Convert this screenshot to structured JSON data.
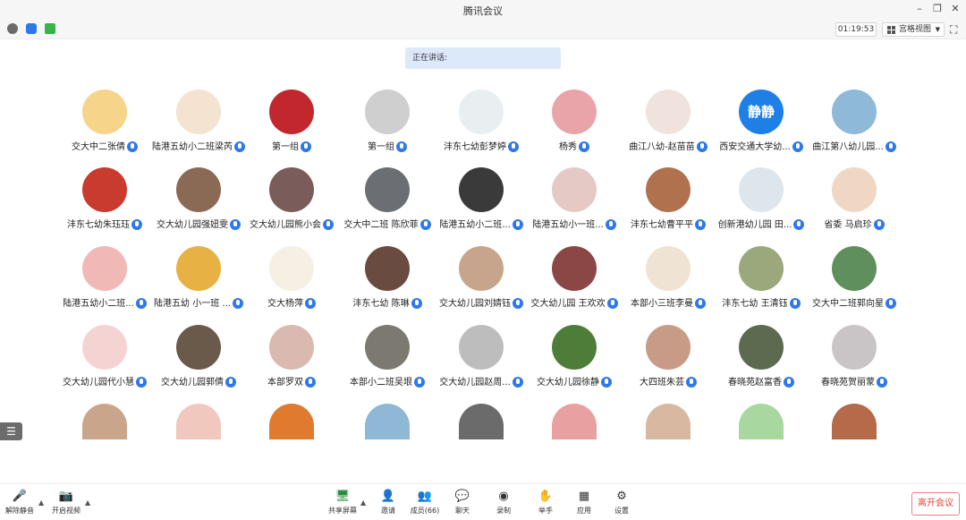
{
  "window": {
    "title": "腾讯会议"
  },
  "top_toolbar": {
    "timer": "01:19:53",
    "view_mode": "宫格视图"
  },
  "speaking": {
    "label": "正在讲话:"
  },
  "participants": [
    {
      "name": "交大中二张倩",
      "avatar_color": "#f6d48a"
    },
    {
      "name": "陆港五幼小二班梁芮",
      "avatar_color": "#f4e3d0"
    },
    {
      "name": "第一组",
      "avatar_color": "#c2272d"
    },
    {
      "name": "第一组",
      "avatar_color": "#cfcfcf"
    },
    {
      "name": "沣东七幼彭梦婷",
      "avatar_color": "#e9eef0"
    },
    {
      "name": "杨秀",
      "avatar_color": "#e8a4a9"
    },
    {
      "name": "曲江八幼-赵苗苗",
      "avatar_color": "#f0e2dd"
    },
    {
      "name": "西安交通大学幼...",
      "avatar_color": "#1e7fe6",
      "avatar_text": "静静"
    },
    {
      "name": "曲江第八幼儿园...",
      "avatar_color": "#8fb9d8"
    },
    {
      "name": "沣东七幼朱珏珏",
      "avatar_color": "#c93a2f"
    },
    {
      "name": "交大幼儿园强妞雯",
      "avatar_color": "#8a6a55"
    },
    {
      "name": "交大幼儿园熊小会",
      "avatar_color": "#7a5c5a"
    },
    {
      "name": "交大中二班 陈欣菲",
      "avatar_color": "#6b6e73"
    },
    {
      "name": "陆港五幼小二班...",
      "avatar_color": "#3a3a3a"
    },
    {
      "name": "陆港五幼小一班...",
      "avatar_color": "#e5c9c4"
    },
    {
      "name": "沣东七幼曹平平",
      "avatar_color": "#b0724e"
    },
    {
      "name": "创新港幼儿园 田...",
      "avatar_color": "#dde6ec"
    },
    {
      "name": "省委 马启珍",
      "avatar_color": "#f0d7c4"
    },
    {
      "name": "陆港五幼小二班...",
      "avatar_color": "#f1b9b5"
    },
    {
      "name": "陆港五幼 小一班 ...",
      "avatar_color": "#e8b143"
    },
    {
      "name": "交大杨萍",
      "avatar_color": "#f5efe4"
    },
    {
      "name": "沣东七幼 陈琳",
      "avatar_color": "#6a4b3f"
    },
    {
      "name": "交大幼儿园刘婧钰",
      "avatar_color": "#c7a58c"
    },
    {
      "name": "交大幼儿园 王欢欢",
      "avatar_color": "#8b4646"
    },
    {
      "name": "本部小三班李曼",
      "avatar_color": "#efe3d4"
    },
    {
      "name": "沣东七幼 王清钰",
      "avatar_color": "#9aa87c"
    },
    {
      "name": "交大中二班郭向星",
      "avatar_color": "#5f8f5c"
    },
    {
      "name": "交大幼儿园代小慧",
      "avatar_color": "#f6d3d3"
    },
    {
      "name": "交大幼儿园郭倩",
      "avatar_color": "#6a5a4a"
    },
    {
      "name": "本部罗双",
      "avatar_color": "#d9b9b0"
    },
    {
      "name": "本部小二班吴垠",
      "avatar_color": "#7c7a70"
    },
    {
      "name": "交大幼儿园赵周...",
      "avatar_color": "#bdbdbd"
    },
    {
      "name": "交大幼儿园徐静",
      "avatar_color": "#4e7d3a"
    },
    {
      "name": "大四班朱芸",
      "avatar_color": "#c79b86"
    },
    {
      "name": "春晓苑赵富香",
      "avatar_color": "#5c6b50"
    },
    {
      "name": "春晓苑贺丽蒙",
      "avatar_color": "#c9c4c6"
    },
    {
      "name": "",
      "avatar_color": "#c9a58c"
    },
    {
      "name": "",
      "avatar_color": "#f1c8bd"
    },
    {
      "name": "",
      "avatar_color": "#e07a2e"
    },
    {
      "name": "",
      "avatar_color": "#8fb8d6"
    },
    {
      "name": "",
      "avatar_color": "#6b6b6b"
    },
    {
      "name": "",
      "avatar_color": "#e8a0a0"
    },
    {
      "name": "",
      "avatar_color": "#d8b8a0"
    },
    {
      "name": "",
      "avatar_color": "#a8d8a0"
    },
    {
      "name": "",
      "avatar_color": "#b56a4a"
    }
  ],
  "bottom_bar": {
    "mute": "解除静音",
    "video": "开启视频",
    "share": "共享屏幕",
    "invite": "邀请",
    "members": "成员(66)",
    "chat": "聊天",
    "record": "录制",
    "raise_hand": "举手",
    "apps": "应用",
    "settings": "设置",
    "leave": "离开会议"
  },
  "colors": {
    "accent": "#2f78e8",
    "danger": "#e0463c"
  }
}
